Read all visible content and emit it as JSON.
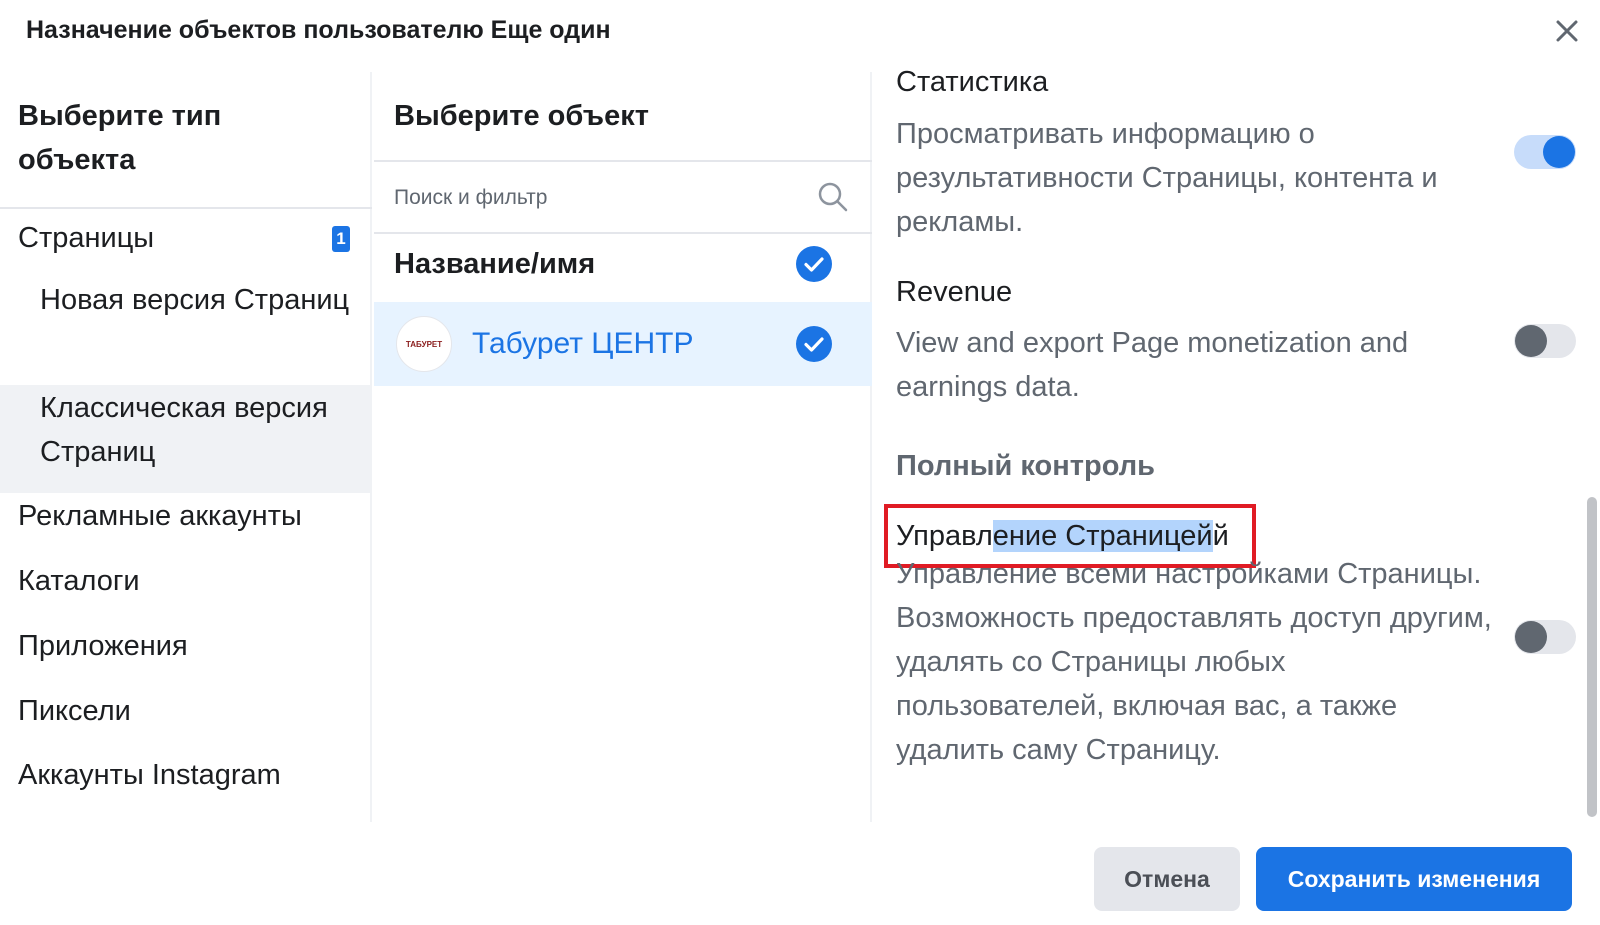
{
  "dialog": {
    "title": "Назначение объектов пользователю Еще один",
    "close_icon": "close-icon"
  },
  "left": {
    "heading": "Выберите тип объекта",
    "items": [
      {
        "label": "Страницы",
        "badge": "1"
      },
      {
        "label": "Новая версия Страниц"
      },
      {
        "label": "Классическая версия Страниц",
        "selected": true
      },
      {
        "label": "Рекламные аккаунты"
      },
      {
        "label": "Каталоги"
      },
      {
        "label": "Приложения"
      },
      {
        "label": "Пиксели"
      },
      {
        "label": "Аккаунты Instagram"
      }
    ]
  },
  "middle": {
    "heading": "Выберите объект",
    "search_placeholder": "Поиск и фильтр",
    "column_header": "Название/имя",
    "rows": [
      {
        "label": "Табурет ЦЕНТР",
        "avatar_text": "ТАБУРЕТ",
        "checked": true
      }
    ]
  },
  "right": {
    "permissions": [
      {
        "title": "Статистика",
        "description": "Просматривать информацию о результативности Страницы, контента и рекламы.",
        "enabled": true
      },
      {
        "title": "Revenue",
        "description": "View and export Page monetization and earnings data.",
        "enabled": false
      }
    ],
    "section_title": "Полный контроль",
    "full_control": {
      "title_pre": "Управл",
      "title_sel": "ение Страницей",
      "title_post": "й",
      "description": "Управление всеми настройками Страницы. Возможность предоставлять доступ другим, удалять со Страницы любых пользователей, включая вас, а также удалить саму Страницу.",
      "enabled": false
    }
  },
  "footer": {
    "cancel": "Отмена",
    "save": "Сохранить изменения"
  },
  "colors": {
    "accent": "#1b74e4",
    "highlight": "#e01b24"
  }
}
